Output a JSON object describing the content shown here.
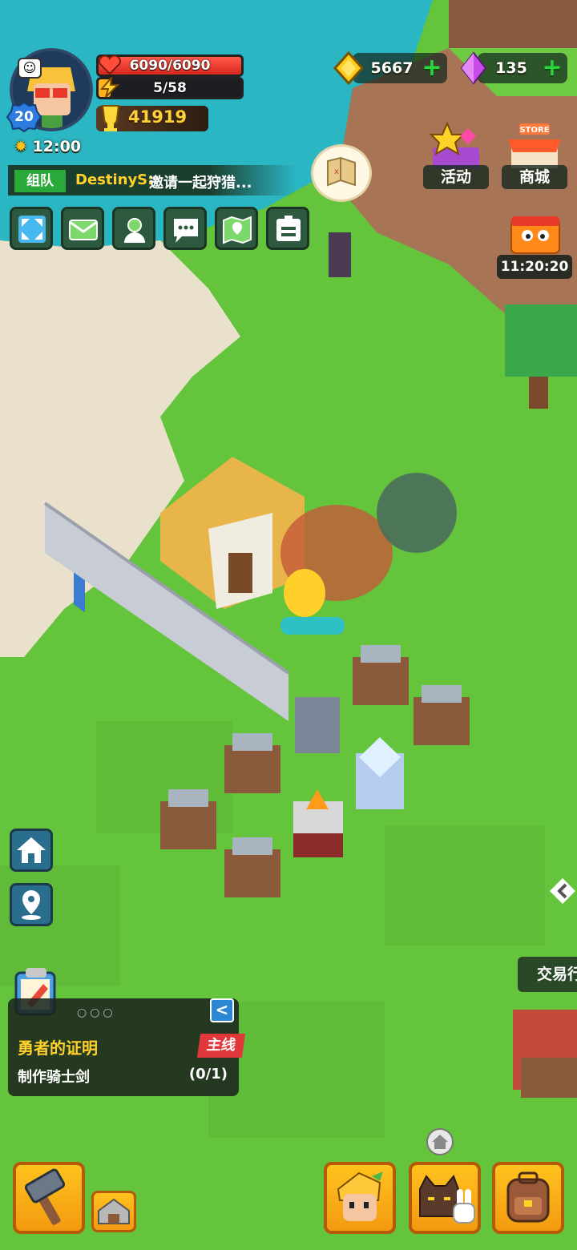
{
  "player": {
    "level": "20",
    "hp_text": "6090/6090",
    "hp_fraction": 1.0,
    "energy_text": "5/58",
    "energy_fraction": 0.086,
    "trophies": "41919",
    "time": "12:00"
  },
  "currencies": [
    {
      "icon": "gold-coin-icon",
      "value": "5667"
    },
    {
      "icon": "purple-gem-icon",
      "value": "135"
    }
  ],
  "right_buttons": {
    "events_label": "活动",
    "store_sign": "STORE",
    "store_label": "商城",
    "gift_timer": "11:20:20"
  },
  "chat": {
    "tag": "组队",
    "name": "DestinyS:",
    "message": "邀请一起狩猎..."
  },
  "function_buttons": [
    "fullscreen-icon",
    "mail-icon",
    "friends-icon",
    "chat-icon",
    "map-icon",
    "id-card-icon"
  ],
  "side_buttons": [
    "home-icon",
    "location-icon"
  ],
  "quest": {
    "dots": "○○○",
    "collapse": "<",
    "title": "勇者的证明",
    "tag": "主线",
    "task": "制作骑士剑",
    "progress": "(0/1)"
  },
  "trade_label": "交易行",
  "bottom_buttons": [
    "build-hammer-icon",
    "build-workshop-icon",
    "character-icon",
    "pets-icon",
    "backpack-icon"
  ],
  "colors": {
    "grass": "#64c43c",
    "water": "#2bb6c4",
    "hp": "#e8372c",
    "accent_gold": "#ffd12a",
    "button_orange": "#f39a10"
  }
}
